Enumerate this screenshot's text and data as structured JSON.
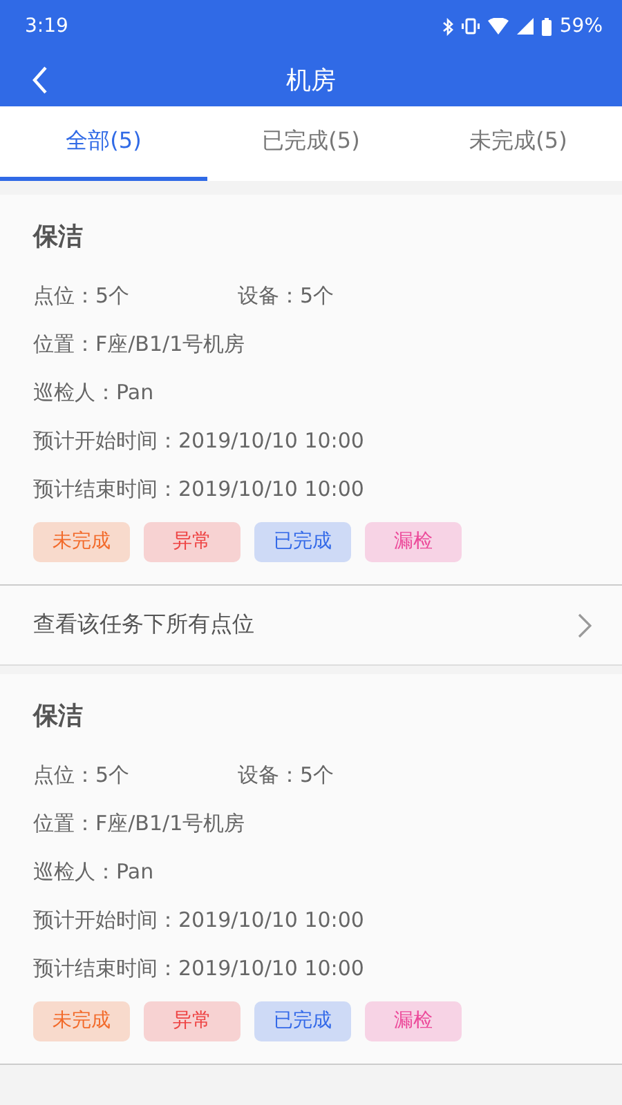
{
  "status_bar": {
    "time": "3:19",
    "battery": "59%"
  },
  "nav": {
    "title": "机房"
  },
  "tabs": [
    {
      "label": "全部(5)",
      "selected": true
    },
    {
      "label": "已完成(5)",
      "selected": false
    },
    {
      "label": "未完成(5)",
      "selected": false
    }
  ],
  "tasks": [
    {
      "title": "保洁",
      "points": "点位：5个",
      "devices": "设备：5个",
      "location": "位置：F座/B1/1号机房",
      "inspector": "巡检人：Pan",
      "start": "预计开始时间：2019/10/10 10:00",
      "end": "预计结束时间：2019/10/10 10:00",
      "tags": [
        {
          "label": "未完成",
          "color": "#f26a2a"
        },
        {
          "label": "异常",
          "color": "#ee4444"
        },
        {
          "label": "已完成",
          "color": "#3369e8"
        },
        {
          "label": "漏检",
          "color": "#ec4a9a"
        }
      ],
      "link": "查看该任务下所有点位"
    },
    {
      "title": "保洁",
      "points": "点位：5个",
      "devices": "设备：5个",
      "location": "位置：F座/B1/1号机房",
      "inspector": "巡检人：Pan",
      "start": "预计开始时间：2019/10/10 10:00",
      "end": "预计结束时间：2019/10/10 10:00",
      "tags": [
        {
          "label": "未完成",
          "color": "#f26a2a"
        },
        {
          "label": "异常",
          "color": "#ee4444"
        },
        {
          "label": "已完成",
          "color": "#3369e8"
        },
        {
          "label": "漏检",
          "color": "#ec4a9a"
        }
      ]
    }
  ]
}
